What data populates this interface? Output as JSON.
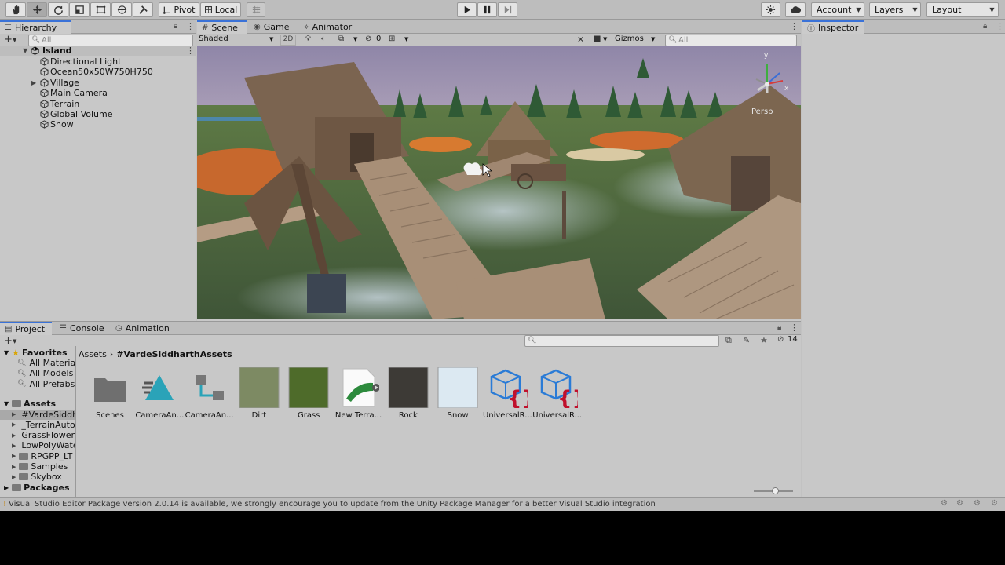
{
  "toolbar": {
    "pivot_label": "Pivot",
    "local_label": "Local",
    "account_label": "Account",
    "layers_label": "Layers",
    "layout_label": "Layout"
  },
  "hierarchy": {
    "tab": "Hierarchy",
    "search_placeholder": "All",
    "scene_name": "Island",
    "items": [
      {
        "label": "Directional Light",
        "expandable": false
      },
      {
        "label": "Ocean50x50W750H750",
        "expandable": false
      },
      {
        "label": "Village",
        "expandable": true
      },
      {
        "label": "Main Camera",
        "expandable": false
      },
      {
        "label": "Terrain",
        "expandable": false
      },
      {
        "label": "Global Volume",
        "expandable": false
      },
      {
        "label": "Snow",
        "expandable": false
      }
    ]
  },
  "scene": {
    "tabs": [
      "Scene",
      "Game",
      "Animator"
    ],
    "shading_mode": "Shaded",
    "mode_2d": "2D",
    "hidden_count": "0",
    "gizmos_label": "Gizmos",
    "search_placeholder": "All",
    "persp_label": "Persp",
    "axis_y": "y",
    "axis_x": "x"
  },
  "inspector": {
    "tab": "Inspector"
  },
  "project": {
    "tabs": [
      "Project",
      "Console",
      "Animation"
    ],
    "favorites_label": "Favorites",
    "favorites": [
      "All Materials",
      "All Models",
      "All Prefabs"
    ],
    "assets_label": "Assets",
    "asset_folders": [
      "#VardeSiddharthAssets",
      "_TerrainAutoUpgrade",
      "GrassFlowers",
      "LowPolyWater",
      "RPGPP_LT",
      "Samples",
      "Skybox"
    ],
    "packages_label": "Packages",
    "breadcrumb_root": "Assets",
    "breadcrumb_current": "#VardeSiddharthAssets",
    "count_label": "14",
    "assets": [
      {
        "label": "Scenes",
        "kind": "folder"
      },
      {
        "label": "CameraAn...",
        "kind": "anim"
      },
      {
        "label": "CameraAn...",
        "kind": "controller"
      },
      {
        "label": "Dirt",
        "kind": "texture",
        "color": "#7d8a63"
      },
      {
        "label": "Grass",
        "kind": "texture",
        "color": "#4e6b2a"
      },
      {
        "label": "New Terra...",
        "kind": "terrain"
      },
      {
        "label": "Rock",
        "kind": "texture",
        "color": "#3d3a36"
      },
      {
        "label": "Snow",
        "kind": "texture",
        "color": "#dce9f2"
      },
      {
        "label": "UniversalR...",
        "kind": "script"
      },
      {
        "label": "UniversalR...",
        "kind": "script"
      }
    ]
  },
  "status": {
    "message": "Visual Studio Editor Package version 2.0.14 is available, we strongly encourage you to update from the Unity Package Manager for a better Visual Studio integration"
  },
  "colors": {
    "accent": "#3a72d8",
    "panel": "#c8c8c8",
    "toolbar": "#bdbdbd",
    "script_blue": "#2a7bd6",
    "script_red": "#c0102c"
  }
}
